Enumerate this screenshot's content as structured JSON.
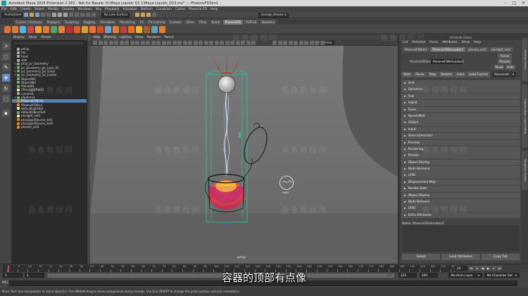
{
  "window": {
    "title": "Autodesk Maya 2016 Extension 2 SP2 - Not for Resale: H:\\Maya Liquids Q1 1\\Maya Liquids_Q53.mx*  ---  PhoenixFDSim1",
    "min": "–",
    "max": "□",
    "close": "✕"
  },
  "menubar": [
    "File",
    "Edit",
    "Create",
    "Select",
    "Modify",
    "Display",
    "Windows",
    "Key",
    "Playback",
    "Visualize",
    "Deform",
    "Constrain",
    "Cache",
    "Phoenix FD",
    "Help"
  ],
  "status": {
    "mode": "Animation",
    "surface": "No Live Surface",
    "user": "George Zhelov"
  },
  "shelf_tabs": [
    "Curves / Surfaces",
    "Polygons",
    "Sculpting",
    "Rigging",
    "Animation",
    "Rendering",
    "FX",
    "FX Caching",
    "Custom",
    "XGen",
    "VRay",
    "Bullet",
    "PhoenixFD",
    "TURTLE",
    "Deadline"
  ],
  "shelf_active": "PhoenixFD",
  "outliner": {
    "menu": [
      "Display",
      "Show",
      "Panels"
    ],
    "items": [
      {
        "label": "persp",
        "type": "cam"
      },
      {
        "label": "top",
        "type": "cam"
      },
      {
        "label": "front",
        "type": "cam"
      },
      {
        "label": "side",
        "type": "cam"
      },
      {
        "label": "pCyl_jar_Geometry",
        "type": "mesh"
      },
      {
        "label": "jar_Geometry_Jar_Lock_01",
        "type": "mesh"
      },
      {
        "label": "jar_Geometry_Jar_Glass",
        "type": "mesh"
      },
      {
        "label": "jar_Geometry_jar_Locker",
        "type": "mesh"
      },
      {
        "label": "Object001",
        "type": "mesh"
      },
      {
        "label": "Object002",
        "type": "mesh"
      },
      {
        "label": "Plane001",
        "type": "mesh"
      },
      {
        "label": "VRayLightRect1",
        "type": "light"
      },
      {
        "label": "camera1",
        "type": "cam"
      },
      {
        "label": "pSphere1",
        "type": "mesh"
      },
      {
        "label": "PhoenixFDSim1",
        "type": "fx",
        "selected": true
      },
      {
        "label": "PhoenixFDSrc1",
        "type": "fx"
      },
      {
        "label": "defaultLightSet",
        "type": "light"
      },
      {
        "label": "defaultObjectSet",
        "type": "mesh"
      },
      {
        "label": "phxlight_set1",
        "type": "light"
      },
      {
        "label": "phxLiquidSource_set1",
        "type": "fx"
      },
      {
        "label": "phxLiquidSource_set2",
        "type": "fx"
      },
      {
        "label": "phxsim_set1",
        "type": "fx"
      }
    ]
  },
  "viewport": {
    "menu": [
      "View",
      "Shading",
      "Lighting",
      "Show",
      "Renderer",
      "Panels"
    ],
    "color_space": "sRGB gamma",
    "camera": "persp"
  },
  "attr_editor": {
    "header": "Attribute Editor",
    "menu": [
      "List",
      "Selected",
      "Focus",
      "Attributes",
      "Show",
      "Help"
    ],
    "tabs": [
      "PhoenixFDSim1",
      "PhoenixFDSimulator1",
      "phxsim_set1",
      "phxlight_set1"
    ],
    "active_tab": "PhoenixFDSimulator1",
    "node_label": "PhoenixFDSimulator:",
    "node_value": "PhoenixFDSimulator1",
    "focus": "Focus",
    "presets": "Presets",
    "show": "Show",
    "hide": "Hide",
    "actions": [
      "Start",
      "Pause",
      "Stop",
      "Restore",
      "Load",
      "Load Current"
    ],
    "advanced": "Advanced",
    "sections": [
      "Grid",
      "Dynamics",
      "Fuel",
      "Liquid",
      "Foam",
      "Splash/Mist",
      "Output",
      "Input",
      "Voxel Interaction",
      "Preview",
      "Rendering",
      "Presets",
      "Object Display",
      "Node Behavior",
      "UUID",
      "Displacement Map",
      "Render Stats",
      "Object Display",
      "Node Behavior",
      "UUID",
      "Extra Attributes"
    ],
    "notes": "Notes:  PhoenixFDSimulator1",
    "bottom": [
      "Select",
      "Load Attributes",
      "Copy Tab"
    ]
  },
  "side_tabs": [
    "Attribute Editor",
    "Channel Box / Layer Editor",
    "Modeling Toolkit"
  ],
  "timeline": {
    "ticks": [
      "1",
      "5",
      "10",
      "15",
      "20",
      "25",
      "30",
      "35",
      "40",
      "45",
      "50",
      "55",
      "60",
      "65",
      "70",
      "75",
      "80",
      "85",
      "90",
      "95",
      "100",
      "105",
      "110",
      "115",
      "120",
      "125",
      "130",
      "135",
      "140",
      "145",
      "150",
      "155",
      "160",
      "165",
      "170",
      "175",
      "180",
      "185",
      "190",
      "195",
      "200",
      "205",
      "210",
      "215"
    ],
    "current": "20",
    "range_start": "1",
    "range_start2": "1",
    "range_inner_start": "1",
    "range_inner_end": "120",
    "range_end": "120",
    "range_end2": "200",
    "anim_layer": "No Anim Layer",
    "char_set": "No Character Set"
  },
  "cmd": {
    "label": "MEL"
  },
  "help_line": "Move Tool: Use manipulator to move object(s). Ctrl+Middle-drag to move components along normals. Use D or INSERT to change the pivot position and axis orientation.",
  "subtitle": "容器的顶部有点像",
  "watermark": "鱼鱼教程网"
}
